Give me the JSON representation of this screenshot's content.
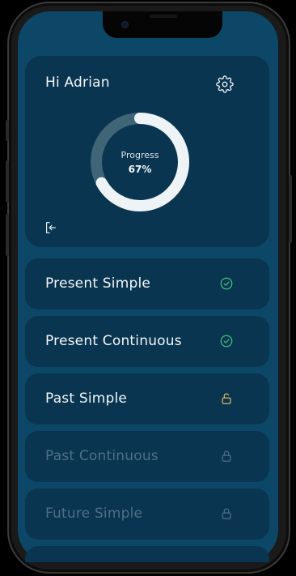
{
  "header": {
    "greeting": "Hi Adrian"
  },
  "progress": {
    "label": "Progress",
    "value_text": "67%",
    "fraction": 0.67,
    "track_color": "#3f6576",
    "fill_color": "#eef3f6"
  },
  "icons": {
    "settings": "gear-icon",
    "logout": "logout-icon",
    "completed": "check-circle-icon",
    "unlocked": "unlock-icon",
    "locked": "lock-icon"
  },
  "colors": {
    "screen_bg": "#0c4767",
    "card_bg": "#0a3550",
    "completed_green": "#3fbf7f",
    "unlocked_yellow": "#d9b95c",
    "locked_gray": "#4e6f87"
  },
  "lessons": [
    {
      "title": "Present Simple",
      "status": "completed"
    },
    {
      "title": "Present Continuous",
      "status": "completed"
    },
    {
      "title": "Past Simple",
      "status": "unlocked"
    },
    {
      "title": "Past Continuous",
      "status": "locked"
    },
    {
      "title": "Future Simple",
      "status": "locked"
    }
  ]
}
